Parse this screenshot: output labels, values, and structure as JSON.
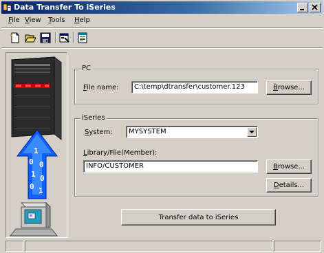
{
  "window": {
    "title": "Data Transfer To iSeries"
  },
  "menu": {
    "items": [
      {
        "label": "File",
        "mnemonic": "F",
        "rest": "ile"
      },
      {
        "label": "View",
        "mnemonic": "V",
        "rest": "iew"
      },
      {
        "label": "Tools",
        "mnemonic": "T",
        "rest": "ools"
      },
      {
        "label": "Help",
        "mnemonic": "H",
        "rest": "elp"
      }
    ]
  },
  "toolbar": {
    "icons": [
      "new-icon",
      "open-icon",
      "save-icon",
      "properties-icon",
      "run-icon"
    ]
  },
  "pc": {
    "group_title": "PC",
    "file_label_mn": "F",
    "file_label_rest": "ile name:",
    "file_value": "C:\\temp\\dtransfer\\customer.123",
    "browse_mn": "B",
    "browse_rest": "rowse..."
  },
  "iseries": {
    "group_title": "iSeries",
    "system_label_mn": "S",
    "system_label_rest": "ystem:",
    "system_value": "MYSYSTEM",
    "library_label_mn": "L",
    "library_label_rest": "ibrary/File(Member):",
    "library_value": "INFO/CUSTOMER",
    "browse_mn": "B",
    "browse_rest": "rowse...",
    "details_mn": "D",
    "details_rest": "etails..."
  },
  "transfer_button": "Transfer data to iSeries",
  "colors": {
    "titlebar_start": "#0a246a",
    "titlebar_end": "#a6caf0",
    "face": "#d4d0c8"
  }
}
